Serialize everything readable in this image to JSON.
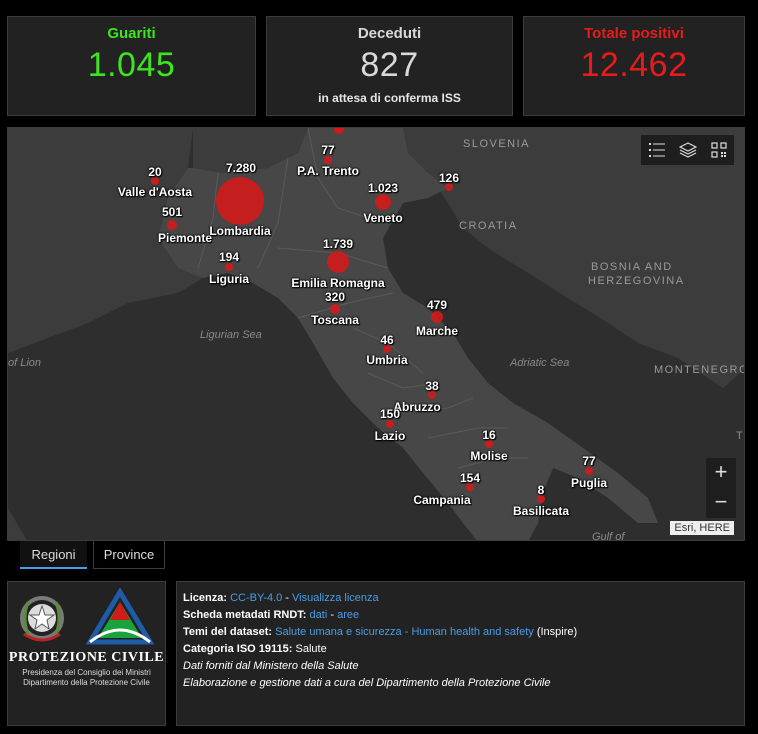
{
  "stats": {
    "guariti": {
      "title": "Guariti",
      "value": "1.045",
      "color": "#3ee51f"
    },
    "deceduti": {
      "title": "Deceduti",
      "value": "827",
      "sub": "in attesa di conferma ISS",
      "color": "#d9d9d9"
    },
    "positivi": {
      "title": "Totale positivi",
      "value": "12.462",
      "color": "#e81b1b"
    }
  },
  "map": {
    "regions": [
      {
        "name": "Valle d'Aosta",
        "value": "20"
      },
      {
        "name": "Piemonte",
        "value": "501"
      },
      {
        "name": "Lombardia",
        "value": "7.280"
      },
      {
        "name": "P.A. Trento",
        "value": "77"
      },
      {
        "name": "Veneto",
        "value": "1.023"
      },
      {
        "name": "",
        "value": "126"
      },
      {
        "name": "Emilia Romagna",
        "value": "1.739"
      },
      {
        "name": "Liguria",
        "value": "194"
      },
      {
        "name": "Toscana",
        "value": "320"
      },
      {
        "name": "Marche",
        "value": "479"
      },
      {
        "name": "Umbria",
        "value": "46"
      },
      {
        "name": "Abruzzo",
        "value": "38"
      },
      {
        "name": "Lazio",
        "value": "150"
      },
      {
        "name": "Molise",
        "value": "16"
      },
      {
        "name": "Campania",
        "value": "154"
      },
      {
        "name": "Puglia",
        "value": "77"
      },
      {
        "name": "Basilicata",
        "value": "8"
      }
    ],
    "countries": {
      "slovenia": "SLOVENIA",
      "croatia": "CROATIA",
      "bosnia1": "BOSNIA AND",
      "bosnia2": "HERZEGOVINA",
      "montenegro": "MONTENEGRO"
    },
    "seas": {
      "ligurian": "Ligurian Sea",
      "adriatic": "Adriatic Sea",
      "lion": "of Lion",
      "gulf": "Gulf of",
      "t": "T"
    },
    "attribution": "Esri, HERE",
    "zoom_in": "+",
    "zoom_out": "−"
  },
  "tabs": {
    "regioni": "Regioni",
    "province": "Province"
  },
  "logo": {
    "title": "PROTEZIONE CIVILE",
    "line1": "Presidenza del Consiglio dei Ministri",
    "line2": "Dipartimento della Protezione Civile"
  },
  "info": {
    "licenza_label": "Licenza:",
    "licenza_link": "CC-BY-4.0",
    "licenza_sep": " - ",
    "licenza_view": "Visualizza licenza",
    "scheda_label": "Scheda metadati RNDT:",
    "scheda_dati": "dati",
    "scheda_sep": " - ",
    "scheda_aree": "aree",
    "temi_label": "Temi del dataset:",
    "temi_link": "Salute umana e sicurezza - Human health and safety",
    "temi_suffix": " (Inspire)",
    "iso_label": "Categoria ISO 19115:",
    "iso_value": " Salute",
    "line_dati": "Dati forniti dal Ministero della Salute",
    "line_elab": "Elaborazione e gestione dati a cura del Dipartimento della Protezione Civile"
  },
  "colors": {
    "marker": "#d11a1a",
    "link": "#4a9de8",
    "land_italy": "#474747",
    "land_other": "#3c3c3c",
    "sea": "#2e2e2e"
  }
}
